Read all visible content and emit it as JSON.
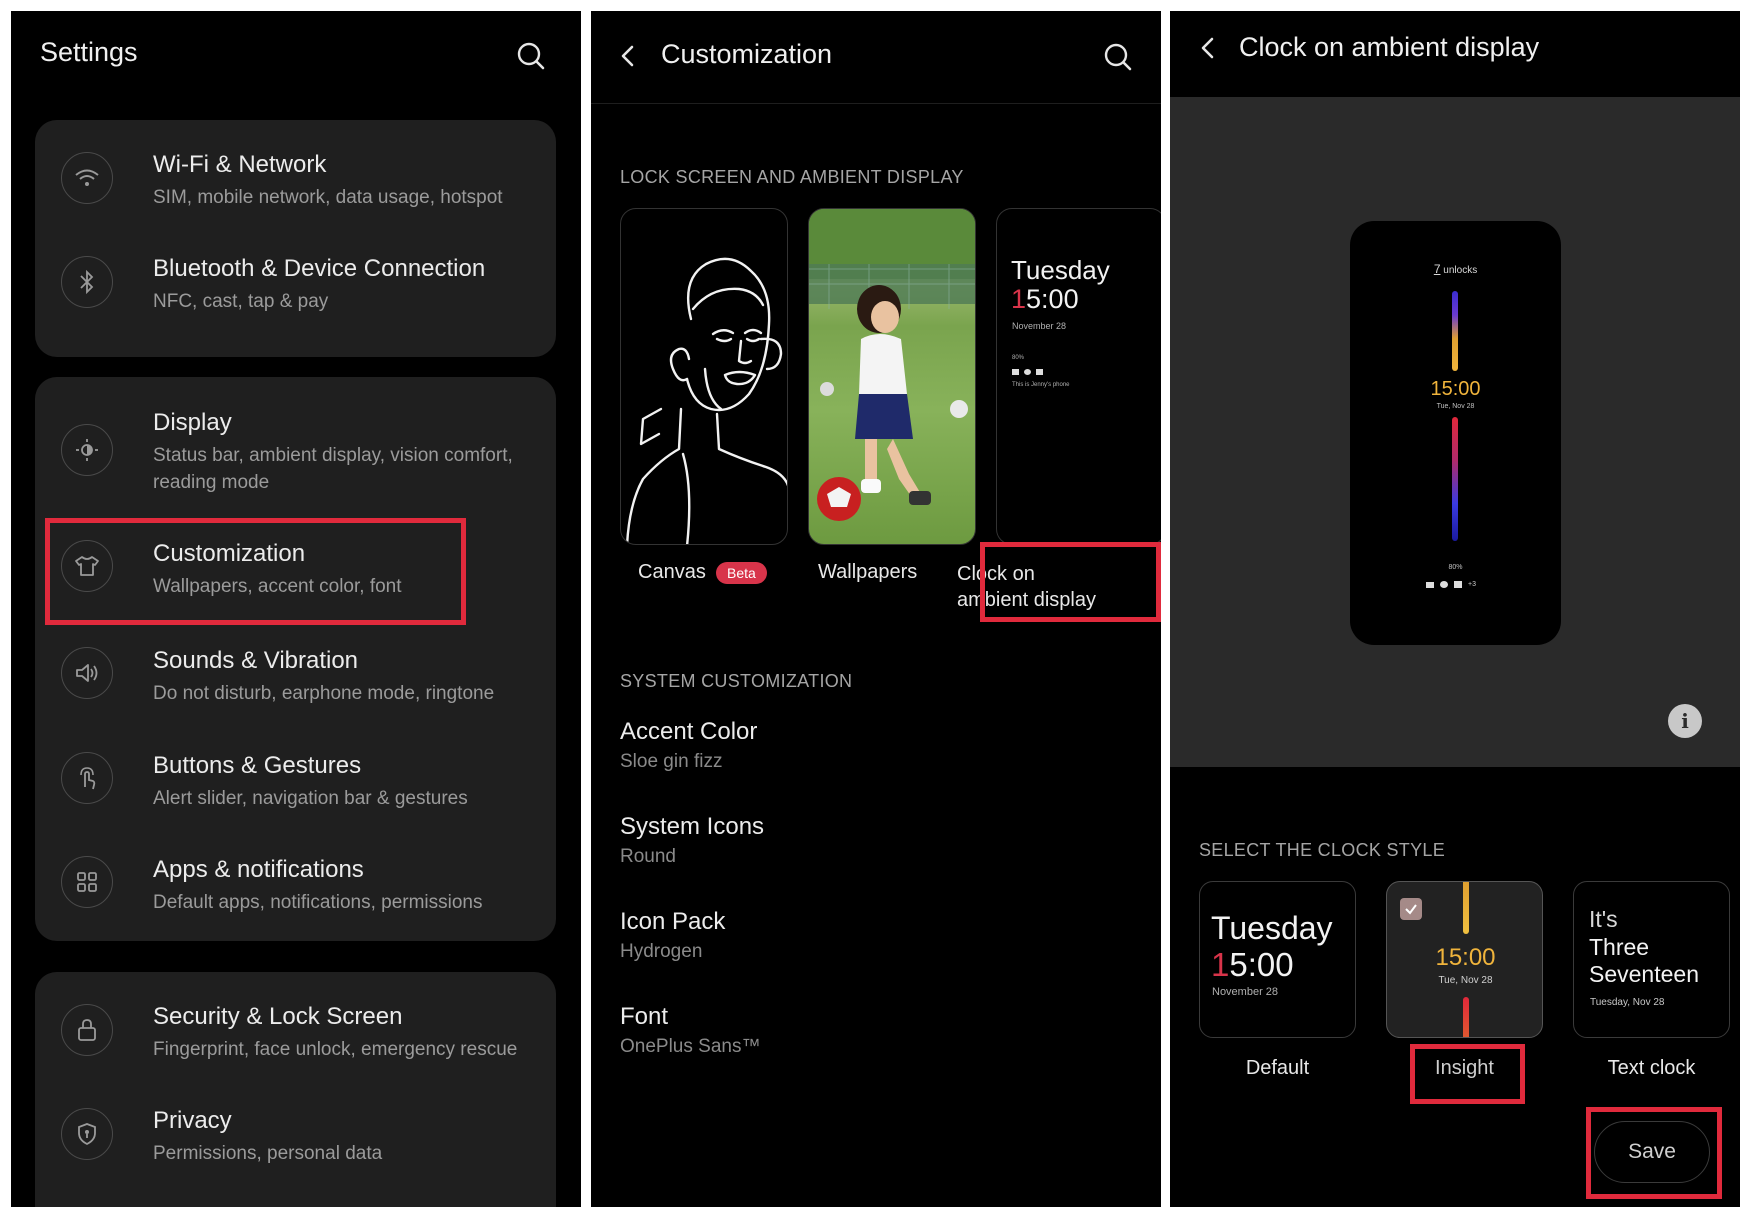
{
  "settings": {
    "title": "Settings",
    "items": [
      {
        "title": "Wi-Fi & Network",
        "subtitle": "SIM, mobile network, data usage, hotspot",
        "icon": "wifi-icon"
      },
      {
        "title": "Bluetooth & Device Connection",
        "subtitle": "NFC, cast, tap & pay",
        "icon": "bluetooth-icon"
      },
      {
        "title": "Display",
        "subtitle": "Status bar, ambient display, vision comfort, reading mode",
        "icon": "brightness-icon"
      },
      {
        "title": "Customization",
        "subtitle": "Wallpapers, accent color, font",
        "icon": "shirt-icon"
      },
      {
        "title": "Sounds & Vibration",
        "subtitle": "Do not disturb, earphone mode, ringtone",
        "icon": "speaker-icon"
      },
      {
        "title": "Buttons & Gestures",
        "subtitle": "Alert slider, navigation bar & gestures",
        "icon": "gesture-icon"
      },
      {
        "title": "Apps & notifications",
        "subtitle": "Default apps, notifications, permissions",
        "icon": "apps-grid-icon"
      },
      {
        "title": "Security & Lock Screen",
        "subtitle": "Fingerprint, face unlock, emergency rescue",
        "icon": "lock-icon"
      },
      {
        "title": "Privacy",
        "subtitle": "Permissions, personal data",
        "icon": "shield-icon"
      }
    ]
  },
  "customization": {
    "title": "Customization",
    "lock_section": "LOCK SCREEN AND AMBIENT DISPLAY",
    "canvas_label": "Canvas",
    "beta_badge": "Beta",
    "wallpapers_label": "Wallpapers",
    "clock_label": "Clock on ambient display",
    "preview": {
      "day": "Tuesday",
      "time_first": "1",
      "time_rest": "5:00",
      "date": "November 28",
      "battery": "80%",
      "owner": "This is Jenny's phone"
    },
    "system_section": "SYSTEM CUSTOMIZATION",
    "items": [
      {
        "title": "Accent Color",
        "value": "Sloe gin fizz"
      },
      {
        "title": "System Icons",
        "value": "Round"
      },
      {
        "title": "Icon Pack",
        "value": "Hydrogen"
      },
      {
        "title": "Font",
        "value": "OnePlus Sans™"
      }
    ]
  },
  "ambient": {
    "title": "Clock on ambient display",
    "phone": {
      "unlock_count": "7",
      "unlock_label": "unlocks",
      "time": "15:00",
      "date": "Tue, Nov 28",
      "battery": "80%",
      "notif_more": "+3"
    },
    "section": "SELECT THE CLOCK STYLE",
    "styles": [
      {
        "name": "Default",
        "day": "Tuesday",
        "time_first": "1",
        "time_rest": "5:00",
        "date": "November 28"
      },
      {
        "name": "Insight",
        "time": "15:00",
        "date": "Tue, Nov 28",
        "selected": true
      },
      {
        "name": "Text clock",
        "line1": "It's",
        "line2": "Three",
        "line3": "Seventeen",
        "date": "Tuesday, Nov 28"
      }
    ],
    "save_label": "Save"
  },
  "colors": {
    "highlight": "#e02a3c",
    "accent_red": "#d8344a",
    "insight_yellow": "#f0b43c"
  }
}
